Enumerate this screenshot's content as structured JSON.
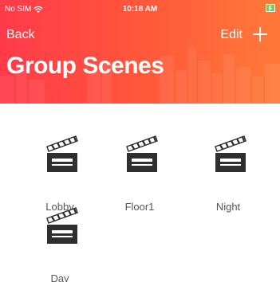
{
  "status_bar": {
    "carrier": "No SIM",
    "time": "10:18 AM",
    "icons": [
      "wifi-icon",
      "battery-icon"
    ]
  },
  "nav": {
    "back_label": "Back",
    "edit_label": "Edit",
    "add_icon": "plus-icon"
  },
  "header": {
    "title": "Group Scenes",
    "colors": {
      "start": "#ff3a4a",
      "end": "#ff7a3a",
      "text": "#ffffff"
    }
  },
  "scenes": [
    {
      "label": "Lobby",
      "icon": "clapperboard-icon"
    },
    {
      "label": "Floor1",
      "icon": "clapperboard-icon"
    },
    {
      "label": "Night",
      "icon": "clapperboard-icon"
    },
    {
      "label": "Day",
      "icon": "clapperboard-icon"
    }
  ]
}
